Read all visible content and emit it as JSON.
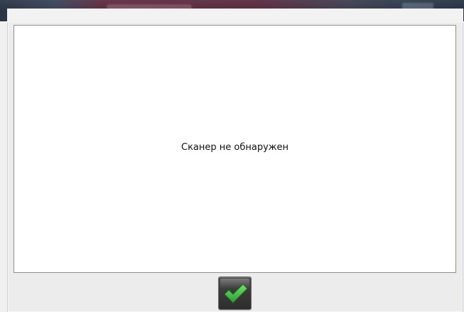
{
  "dialog": {
    "message": "Сканер не обнаружен"
  },
  "buttons": {
    "ok_icon": "checkmark-icon"
  },
  "colors": {
    "panel_background": "#ffffff",
    "panel_border": "#8f8f8f",
    "window_background": "#ececec",
    "button_background": "#3a3a3a",
    "checkmark": "#4cc24a"
  }
}
